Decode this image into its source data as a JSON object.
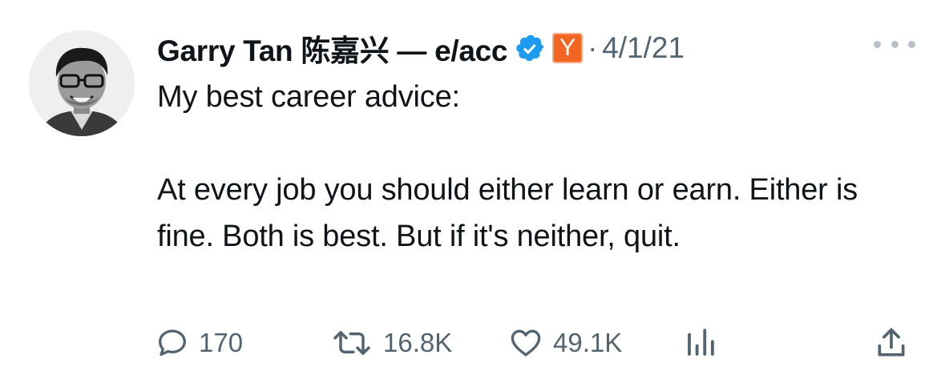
{
  "author": {
    "display_name": "Garry Tan 陈嘉兴 — e/acc",
    "verified_badge_icon": "verified-badge-icon",
    "affiliate_badge_text": "Y",
    "affiliate_badge_color": "#f26522",
    "date": "4/1/21"
  },
  "separator": "·",
  "tweet": {
    "lines": [
      "My best career advice:",
      "At every job you should either learn or earn. Either is fine. Both is best. But if it's neither, quit."
    ]
  },
  "actions": {
    "reply": {
      "icon": "reply-icon",
      "count": "170"
    },
    "retweet": {
      "icon": "retweet-icon",
      "count": "16.8K"
    },
    "like": {
      "icon": "heart-icon",
      "count": "49.1K"
    },
    "views": {
      "icon": "views-chart-icon"
    },
    "share": {
      "icon": "share-icon"
    }
  },
  "colors": {
    "text": "#0f1419",
    "secondary": "#536471",
    "verified_blue": "#1d9bf0"
  }
}
